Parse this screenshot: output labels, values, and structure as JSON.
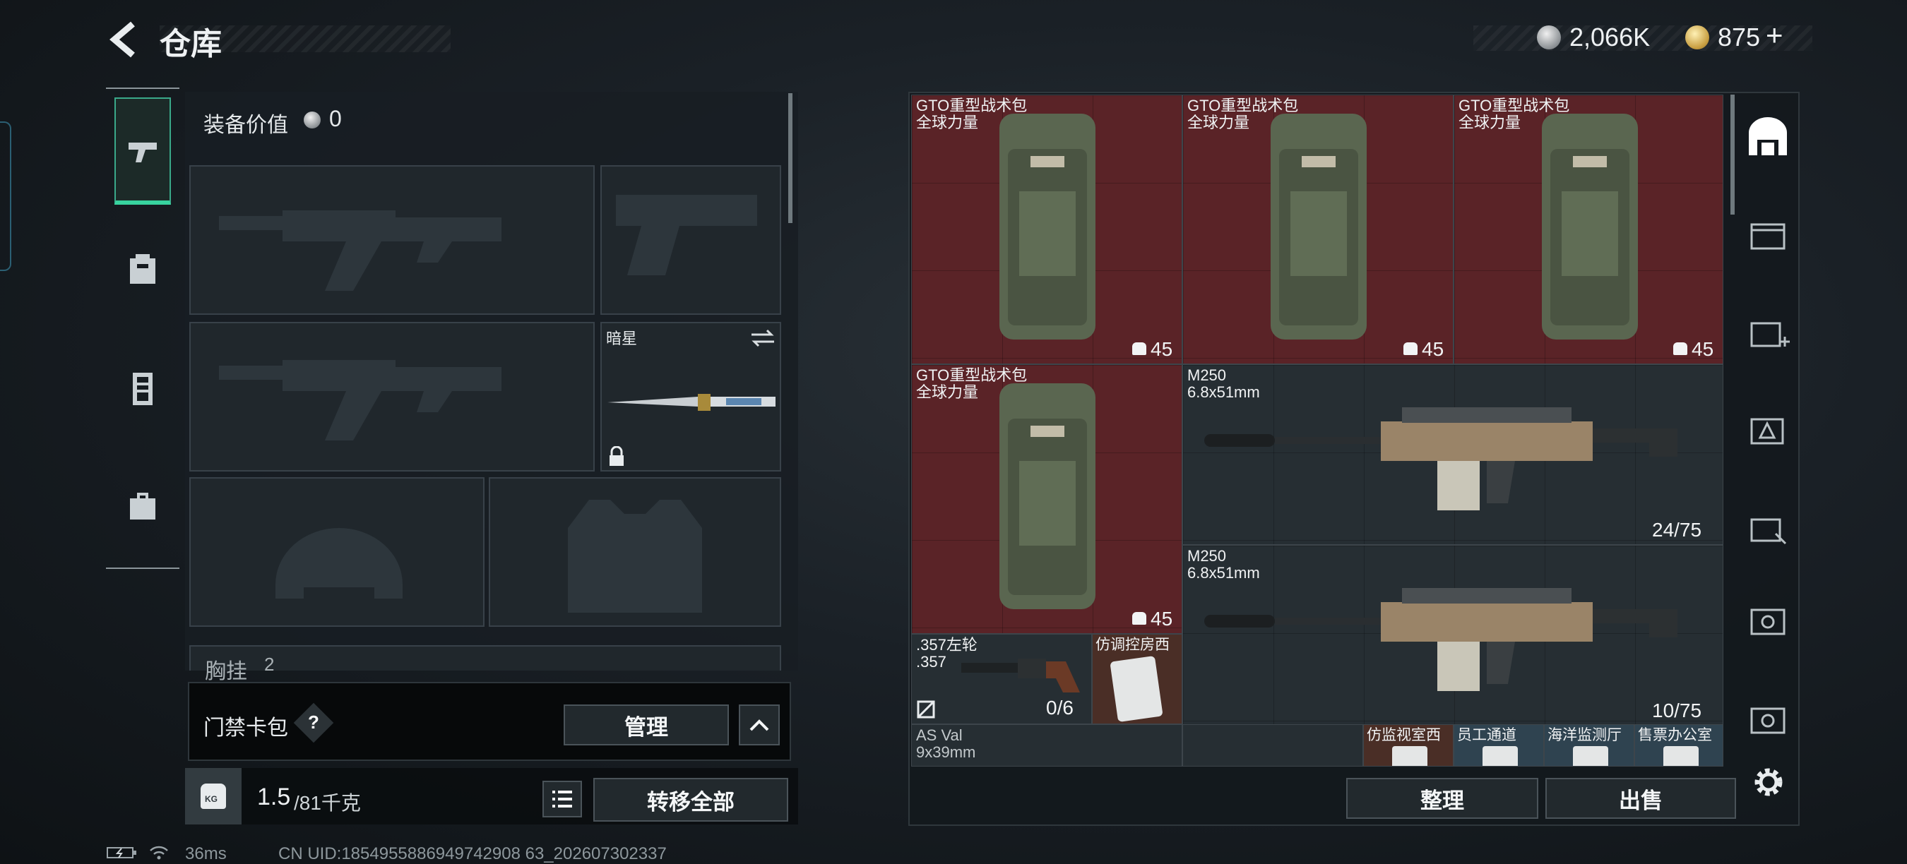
{
  "header": {
    "title": "仓库",
    "currency1": "2,066K",
    "currency2": "875",
    "plus": "+"
  },
  "left": {
    "equip_label": "装备价值",
    "equip_value": "0",
    "melee_name": "暗星",
    "chest_label": "胸挂",
    "chest_count": "2",
    "keycard_label": "门禁卡包",
    "help": "?",
    "manage": "管理",
    "weight_value": "1.5",
    "weight_total": "/81千克",
    "kg_tag": "KG",
    "transfer_all": "转移全部"
  },
  "stash": {
    "items": [
      {
        "name": "GTO重型战术包",
        "sub": "全球力量",
        "count": "45"
      },
      {
        "name": "GTO重型战术包",
        "sub": "全球力量",
        "count": "45"
      },
      {
        "name": "GTO重型战术包",
        "sub": "全球力量",
        "count": "45"
      },
      {
        "name": "GTO重型战术包",
        "sub": "全球力量",
        "count": "45"
      },
      {
        "name": "M250",
        "sub": "6.8x51mm",
        "count": "24/75"
      },
      {
        "name": "M250",
        "sub": "6.8x51mm",
        "count": "10/75"
      },
      {
        "name": ".357左轮",
        "sub": ".357",
        "count": "0/6"
      },
      {
        "name": "仿调控房西"
      },
      {
        "name": "AS Val",
        "sub": "9x39mm"
      },
      {
        "name": "仿监视室西"
      },
      {
        "name": "员工通道"
      },
      {
        "name": "海洋监测厅"
      },
      {
        "name": "售票办公室"
      }
    ],
    "sort": "整理",
    "sell": "出售"
  },
  "status": {
    "ping": "36ms",
    "uid": "CN UID:1854955886949742908 63_202607302337"
  },
  "colors": {
    "accent_green": "#38d39f",
    "item_red": "#5a2327",
    "panel": "#181e23"
  },
  "icons": [
    "back-arrow-icon",
    "silver-coin-icon",
    "gold-coin-icon",
    "pistol-icon",
    "backpack-icon",
    "vest-icon",
    "toolbox-icon",
    "lock-icon",
    "swap-icon",
    "help-icon",
    "chevron-up-icon",
    "list-icon",
    "kg-weight-icon",
    "stash-icon",
    "gear-icon",
    "battery-icon",
    "wifi-icon"
  ]
}
